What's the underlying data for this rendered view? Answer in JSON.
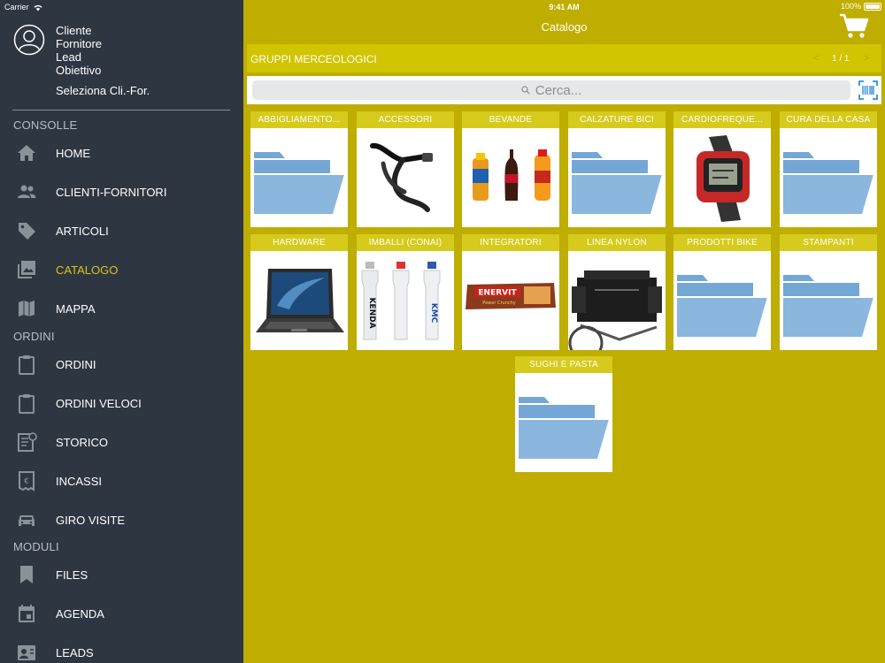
{
  "status": {
    "carrier": "Carrier",
    "time": "9:41 AM",
    "battery": "100%"
  },
  "sidebar": {
    "profile_lines": [
      "Cliente",
      "Fornitore",
      "Lead",
      "Obiettivo"
    ],
    "select_client": "Seleziona Cli.-For.",
    "sections": {
      "consolle": "CONSOLLE",
      "ordini": "ORDINI",
      "moduli": "MODULI"
    },
    "items": [
      {
        "label": "HOME",
        "icon": "home-icon"
      },
      {
        "label": "CLIENTI-FORNITORI",
        "icon": "people-icon"
      },
      {
        "label": "ARTICOLI",
        "icon": "tag-icon"
      },
      {
        "label": "CATALOGO",
        "icon": "gallery-icon",
        "active": true
      },
      {
        "label": "MAPPA",
        "icon": "map-icon"
      },
      {
        "label": "ORDINI",
        "icon": "clipboard-icon"
      },
      {
        "label": "ORDINI VELOCI",
        "icon": "clipboard-fast-icon"
      },
      {
        "label": "STORICO",
        "icon": "history-icon"
      },
      {
        "label": "INCASSI",
        "icon": "euro-receipt-icon"
      },
      {
        "label": "GIRO VISITE",
        "icon": "car-icon"
      },
      {
        "label": "FILES",
        "icon": "bookmark-icon"
      },
      {
        "label": "AGENDA",
        "icon": "calendar-icon"
      },
      {
        "label": "LEADS",
        "icon": "contact-card-icon"
      }
    ]
  },
  "header": {
    "title": "Catalogo",
    "cart_icon": "cart-icon"
  },
  "groups": {
    "title": "GRUPPI MERCEOLOGICI",
    "pager": "1 / 1",
    "prev": "<",
    "next": ">"
  },
  "search": {
    "placeholder": "Cerca..."
  },
  "tiles": [
    {
      "label": "ABBIGLIAMENTO...",
      "image": "folder"
    },
    {
      "label": "ACCESSORI",
      "image": "handlebar"
    },
    {
      "label": "BEVANDE",
      "image": "drinks"
    },
    {
      "label": "CALZATURE BICI",
      "image": "folder"
    },
    {
      "label": "CARDIOFREQUE...",
      "image": "watch"
    },
    {
      "label": "CURA DELLA CASA",
      "image": "folder"
    },
    {
      "label": "HARDWARE",
      "image": "laptop"
    },
    {
      "label": "IMBALLI (CONAI)",
      "image": "bottles",
      "bottle_texts": [
        "KENDA",
        "",
        "KMC"
      ]
    },
    {
      "label": "INTEGRATORI",
      "image": "bar",
      "bar_brand": "ENERVIT",
      "bar_sub": "Power Crunchy"
    },
    {
      "label": "LINEA NYLON",
      "image": "bag"
    },
    {
      "label": "PRODOTTI BIKE",
      "image": "folder"
    },
    {
      "label": "STAMPANTI",
      "image": "folder"
    },
    {
      "label": "SUGHI E PASTA",
      "image": "folder"
    }
  ],
  "colors": {
    "accent": "#bfad00",
    "sidebar_bg": "#2e3642",
    "active_label": "#d4c81a",
    "folder": "#74a7d6"
  }
}
